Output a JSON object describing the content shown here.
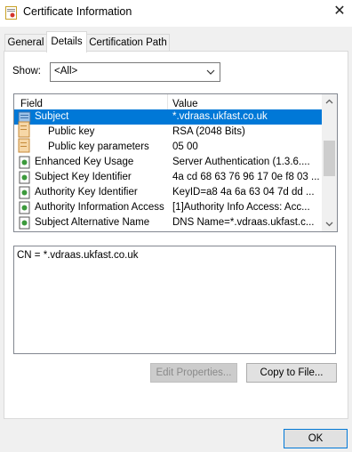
{
  "window": {
    "title": "Certificate Information",
    "close_glyph": "✕"
  },
  "tabs": [
    {
      "label": "General",
      "active": false
    },
    {
      "label": "Details",
      "active": true
    },
    {
      "label": "Certification Path",
      "active": false
    }
  ],
  "show": {
    "label": "Show:",
    "selected": "<All>"
  },
  "list": {
    "headers": {
      "field": "Field",
      "value": "Value"
    },
    "rows": [
      {
        "field": "Subject",
        "value": "*.vdraas.ukfast.co.uk",
        "icon": "certificate-field-icon",
        "selected": true
      },
      {
        "field": "Public key",
        "value": "RSA (2048 Bits)",
        "icon": "document-icon",
        "selected": false
      },
      {
        "field": "Public key parameters",
        "value": "05 00",
        "icon": "document-icon",
        "selected": false
      },
      {
        "field": "Enhanced Key Usage",
        "value": "Server Authentication (1.3.6....",
        "icon": "extension-icon",
        "selected": false
      },
      {
        "field": "Subject Key Identifier",
        "value": "4a cd 68 63 76 96 17 0e f8 03 ...",
        "icon": "extension-icon",
        "selected": false
      },
      {
        "field": "Authority Key Identifier",
        "value": "KeyID=a8 4a 6a 63 04 7d dd ...",
        "icon": "extension-icon",
        "selected": false
      },
      {
        "field": "Authority Information Access",
        "value": "[1]Authority Info Access: Acc...",
        "icon": "extension-icon",
        "selected": false
      },
      {
        "field": "Subject Alternative Name",
        "value": "DNS Name=*.vdraas.ukfast.c...",
        "icon": "extension-icon",
        "selected": false
      }
    ]
  },
  "detail": {
    "text": "CN = *.vdraas.ukfast.co.uk"
  },
  "buttons": {
    "edit_properties": "Edit Properties...",
    "copy_to_file": "Copy to File...",
    "ok": "OK"
  },
  "colors": {
    "selection": "#0078d7",
    "accent": "#0078d7"
  }
}
